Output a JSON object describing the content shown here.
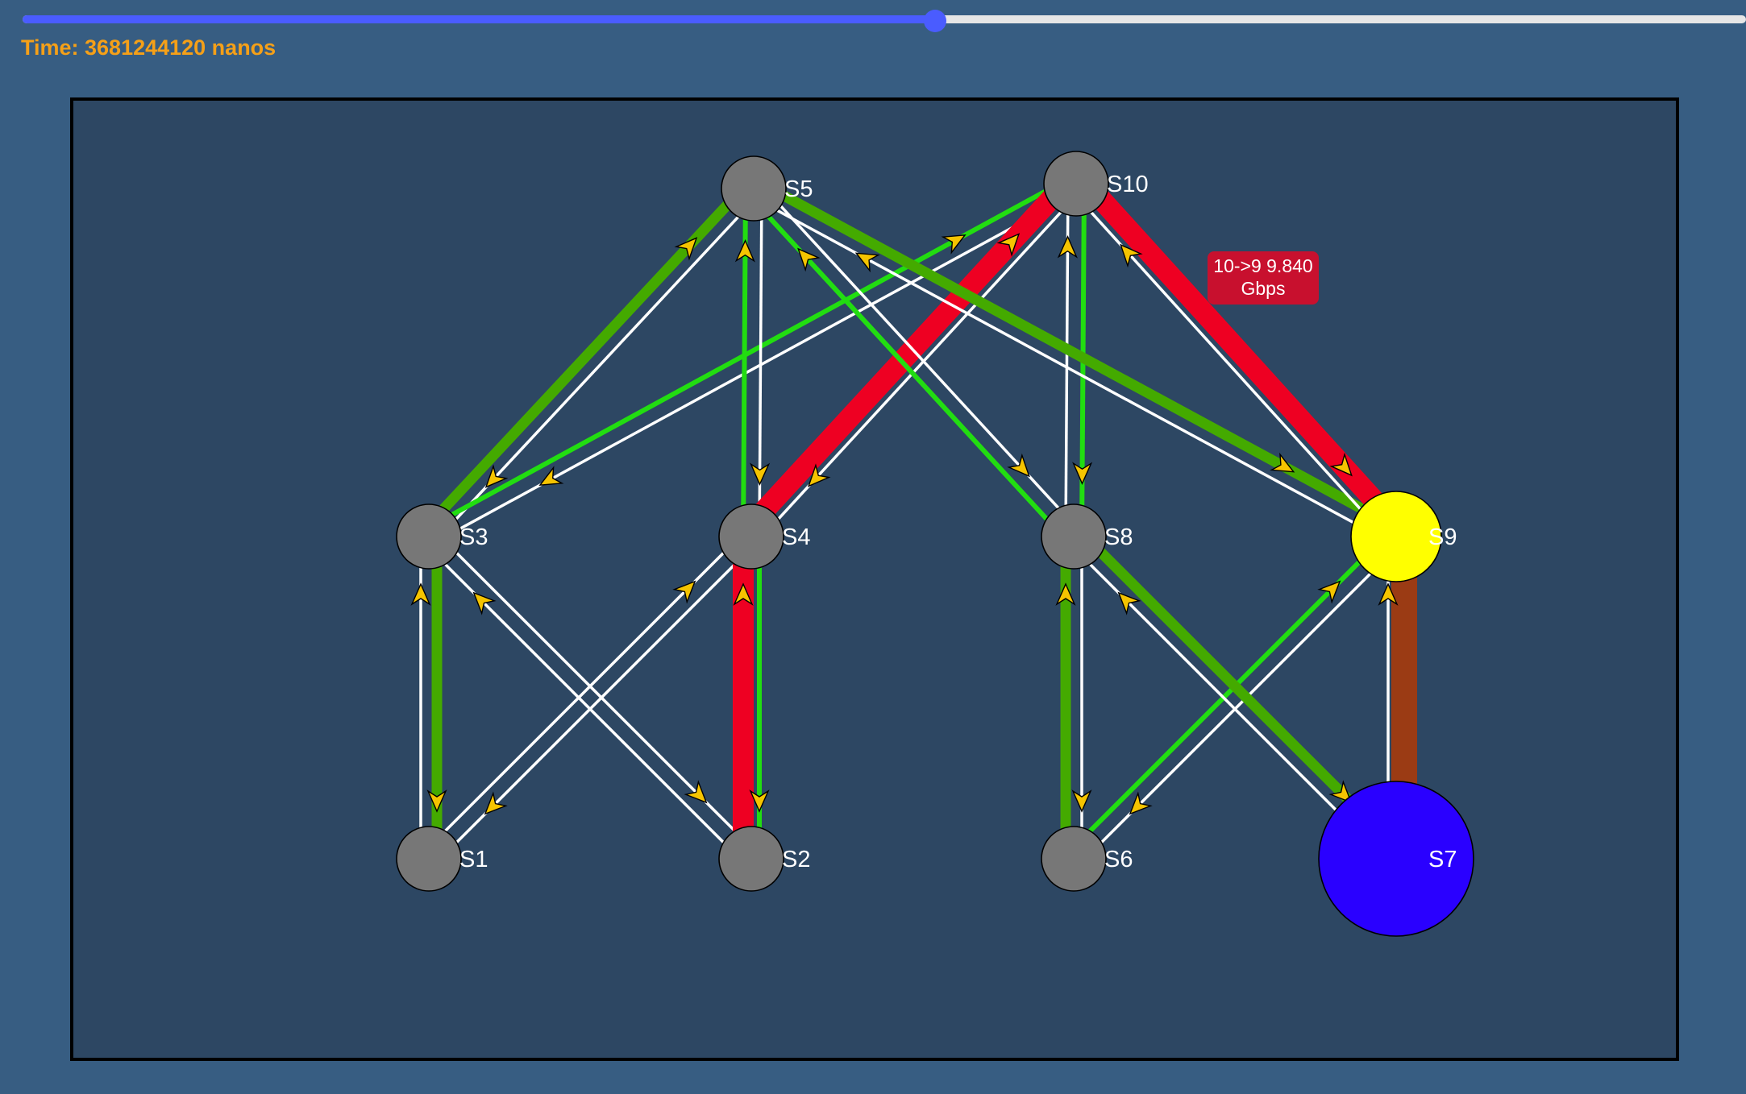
{
  "timeline": {
    "time_label": "Time: 3681244120 nanos",
    "progress": 0.5296
  },
  "colors": {
    "page_background": "#375d82",
    "canvas_background": "#2d4763",
    "thumb": "#4a5cff",
    "time_text": "#f5a018",
    "node_default": "#777777",
    "node_highlight_source": "#ffff00",
    "node_highlight_dest": "#2a00ff",
    "link_idle": "#ffffff",
    "link_low": "#22dd11",
    "link_mid": "#44aa00",
    "link_high": "#ee0022",
    "link_warm": "#9b3b14",
    "arrow": "#f5c400",
    "tooltip_bg": "#c8102e"
  },
  "nodes": [
    {
      "id": "S1",
      "label": "S1",
      "state": "default"
    },
    {
      "id": "S2",
      "label": "S2",
      "state": "default"
    },
    {
      "id": "S3",
      "label": "S3",
      "state": "default"
    },
    {
      "id": "S4",
      "label": "S4",
      "state": "default"
    },
    {
      "id": "S5",
      "label": "S5",
      "state": "default"
    },
    {
      "id": "S6",
      "label": "S6",
      "state": "default"
    },
    {
      "id": "S7",
      "label": "S7",
      "state": "destination"
    },
    {
      "id": "S8",
      "label": "S8",
      "state": "default"
    },
    {
      "id": "S9",
      "label": "S9",
      "state": "source"
    },
    {
      "id": "S10",
      "label": "S10",
      "state": "default"
    }
  ],
  "links": [
    {
      "a": "S1",
      "b": "S3",
      "ab": "idle",
      "ba": "mid"
    },
    {
      "a": "S1",
      "b": "S4",
      "ab": "idle",
      "ba": "idle"
    },
    {
      "a": "S2",
      "b": "S3",
      "ab": "idle",
      "ba": "idle"
    },
    {
      "a": "S2",
      "b": "S4",
      "ab": "high",
      "ba": "low"
    },
    {
      "a": "S6",
      "b": "S8",
      "ab": "mid",
      "ba": "idle"
    },
    {
      "a": "S6",
      "b": "S9",
      "ab": "low",
      "ba": "idle"
    },
    {
      "a": "S7",
      "b": "S8",
      "ab": "idle",
      "ba": "mid"
    },
    {
      "a": "S7",
      "b": "S9",
      "ab": "idle",
      "ba": "warm"
    },
    {
      "a": "S3",
      "b": "S5",
      "ab": "mid",
      "ba": "idle"
    },
    {
      "a": "S3",
      "b": "S10",
      "ab": "low",
      "ba": "idle"
    },
    {
      "a": "S4",
      "b": "S5",
      "ab": "low",
      "ba": "idle"
    },
    {
      "a": "S4",
      "b": "S10",
      "ab": "high",
      "ba": "idle"
    },
    {
      "a": "S8",
      "b": "S5",
      "ab": "low",
      "ba": "idle"
    },
    {
      "a": "S8",
      "b": "S10",
      "ab": "idle",
      "ba": "low"
    },
    {
      "a": "S9",
      "b": "S5",
      "ab": "idle",
      "ba": "mid"
    },
    {
      "a": "S9",
      "b": "S10",
      "ab": "idle",
      "ba": "high"
    }
  ],
  "tooltip": {
    "line1": "10->9 9.840",
    "line2": "Gbps"
  }
}
